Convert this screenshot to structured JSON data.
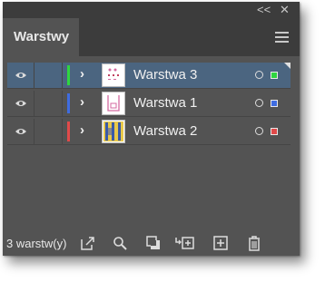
{
  "titlebar": {
    "collapse_label": "<<",
    "close_label": "✕"
  },
  "panel": {
    "tab_title": "Warstwy"
  },
  "layers": [
    {
      "name": "Warstwa 3",
      "color": "#2fd640",
      "selected": true
    },
    {
      "name": "Warstwa 1",
      "color": "#3f6ce0",
      "selected": false
    },
    {
      "name": "Warstwa 2",
      "color": "#e04a4a",
      "selected": false
    }
  ],
  "footer": {
    "layer_count_label": "3 warstw(y)"
  },
  "icons": {
    "visibility": "eye-icon",
    "expand": "chevron-right-icon",
    "target": "circle-target-icon",
    "menu": "hamburger-menu-icon",
    "export": "export-icon",
    "search": "search-icon",
    "clip": "clipping-mask-icon",
    "sublayer": "new-sublayer-icon",
    "newlayer": "new-layer-icon",
    "delete": "trash-icon"
  }
}
